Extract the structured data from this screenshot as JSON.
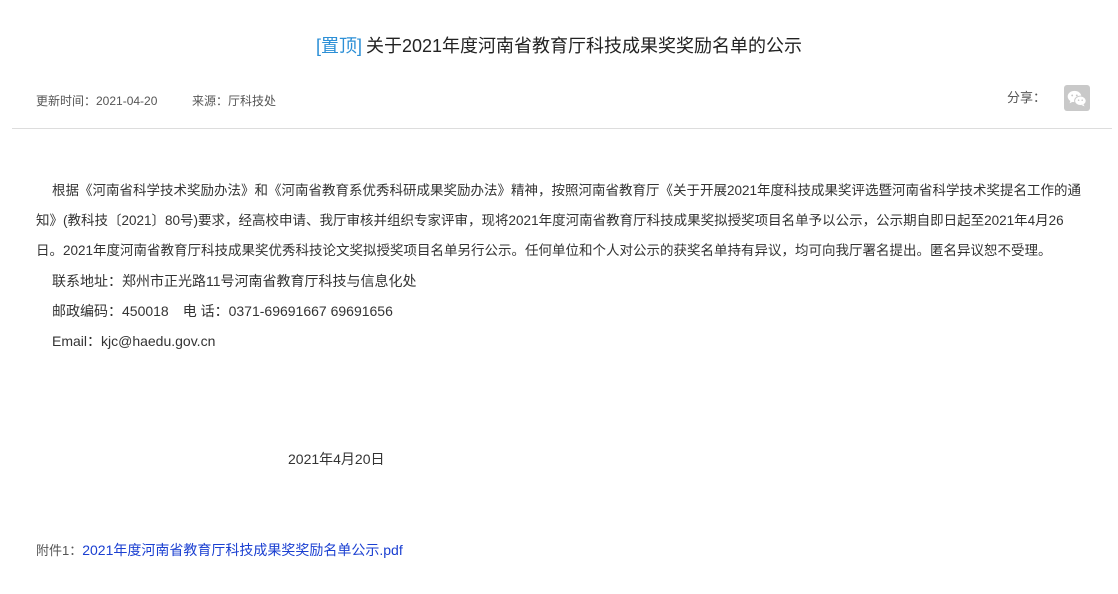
{
  "article": {
    "pin_tag": "[置顶]",
    "title": "关于2021年度河南省教育厅科技成果奖奖励名单的公示"
  },
  "meta": {
    "updated": "更新时间：2021-04-20",
    "source": "来源：厅科技处",
    "share_label": "分享："
  },
  "icons": {
    "share": "wechat-icon"
  },
  "body": {
    "paragraph": "根据《河南省科学技术奖励办法》和《河南省教育系优秀科研成果奖励办法》精神，按照河南省教育厅《关于开展2021年度科技成果奖评选暨河南省科学技术奖提名工作的通知》(教科技〔2021〕80号)要求，经高校申请、我厅审核并组织专家评审，现将2021年度河南省教育厅科技成果奖拟授奖项目名单予以公示，公示期自即日起至2021年4月26日。2021年度河南省教育厅科技成果奖优秀科技论文奖拟授奖项目名单另行公示。任何单位和个人对公示的获奖名单持有异议，均可向我厅署名提出。匿名异议恕不受理。",
    "address": "联系地址：郑州市正光路11号河南省教育厅科技与信息化处",
    "postal_phone": "邮政编码：450018　电 话：0371-69691667 69691656",
    "email": "Email：kjc@haedu.gov.cn",
    "date": "2021年4月20日"
  },
  "attachment": {
    "label": "附件1：",
    "link_text": "2021年度河南省教育厅科技成果奖奖励名单公示.pdf"
  },
  "colors": {
    "pin_tag": "#2c8fd6",
    "link": "#1a3fd1",
    "divider": "#dddddd",
    "share_button_bg": "#c9c9c9"
  }
}
